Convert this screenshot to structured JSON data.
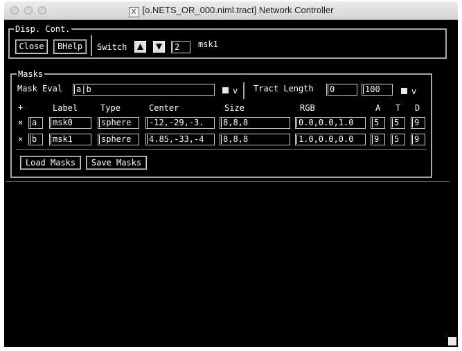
{
  "window": {
    "title": "[o.NETS_OR_000.niml.tract] Network Controller",
    "xlogo": "X"
  },
  "disp_cont": {
    "label": "Disp. Cont.",
    "close_label": "Close",
    "bhelp_label": "BHelp",
    "switch_label": "Switch",
    "switch_value": "2",
    "switch_name": "msk1",
    "up_icon": "triangle-up-icon",
    "down_icon": "triangle-down-icon"
  },
  "masks": {
    "label": "Masks",
    "mask_eval_label": "Mask Eval",
    "mask_eval_value": "a|b",
    "mask_eval_v": "v",
    "tract_length_label": "Tract Length",
    "tract_min": "0",
    "tract_max": "100",
    "tract_v": "v",
    "headers": {
      "plus": "+",
      "label": "Label",
      "type": "Type",
      "center": "Center",
      "size": "Size",
      "rgb": "RGB",
      "a": "A",
      "t": "T",
      "d": "D"
    },
    "rows": [
      {
        "x": "×",
        "letter": "a",
        "label": "msk0",
        "type": "sphere",
        "center": "-12,-29,-3.",
        "size": "8,8,8",
        "rgb": "0.0,0.0,1.0",
        "a": "5",
        "t": "5",
        "d": "9"
      },
      {
        "x": "×",
        "letter": "b",
        "label": "msk1",
        "type": "sphere",
        "center": "4.85,-33,-4",
        "size": "8,8,8",
        "rgb": "1.0,0.0,0.0",
        "a": "9",
        "t": "5",
        "d": "9"
      }
    ],
    "load_label": "Load Masks",
    "save_label": "Save Masks"
  }
}
